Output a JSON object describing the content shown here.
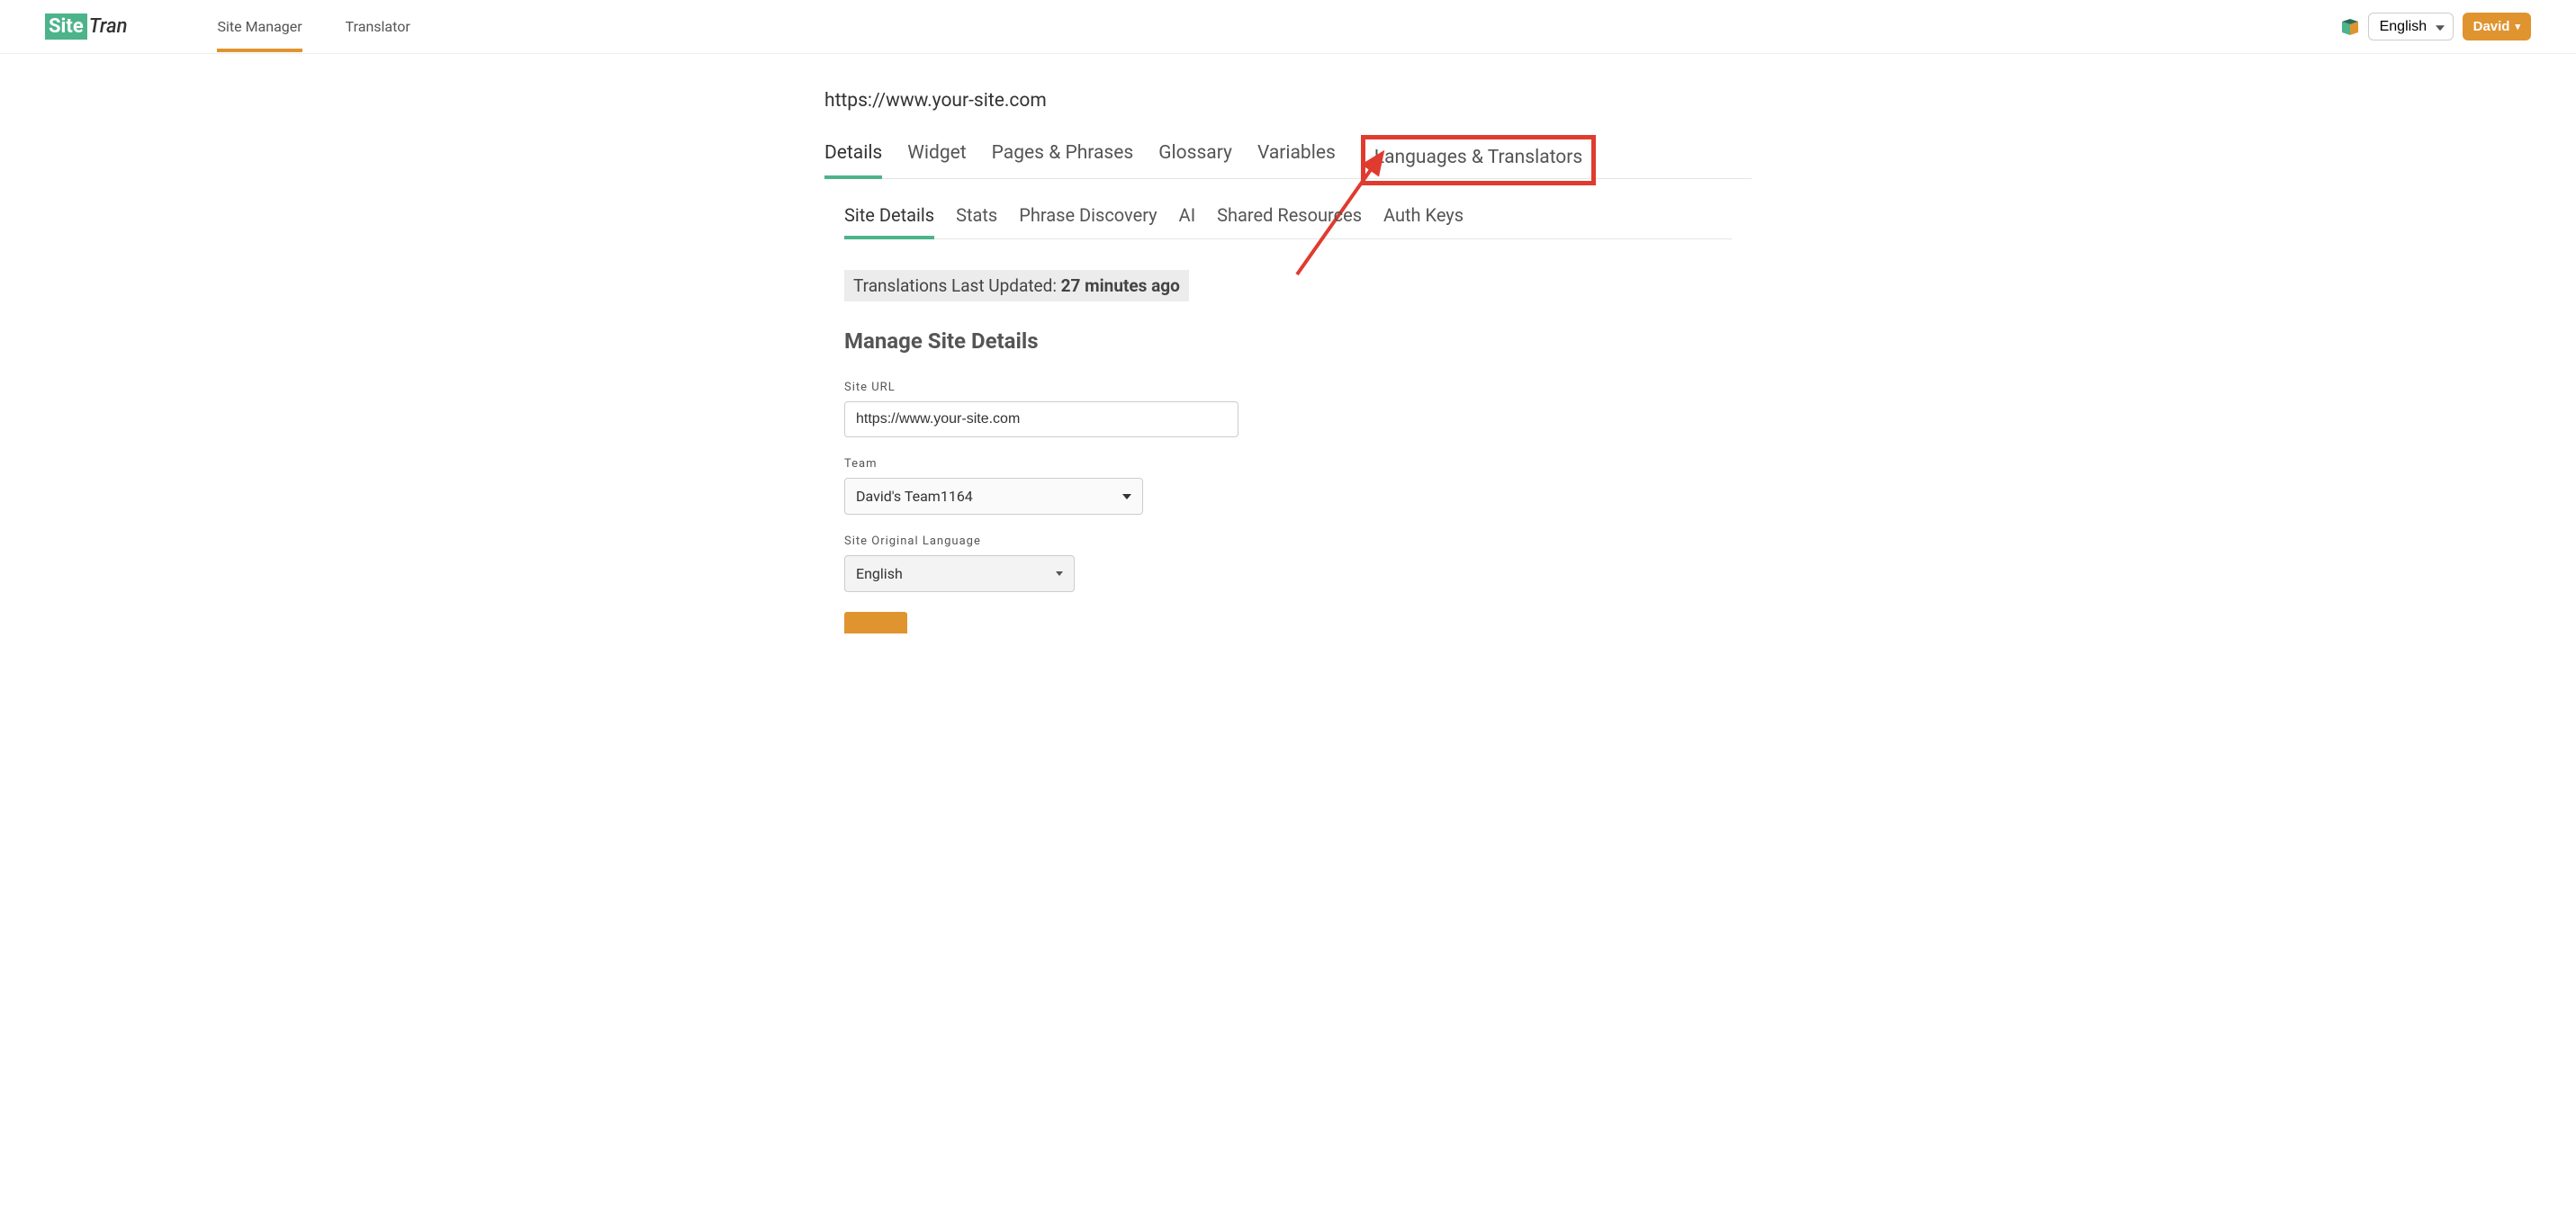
{
  "topnav": {
    "site_manager": "Site Manager",
    "translator": "Translator"
  },
  "header": {
    "language": "English",
    "user": "David"
  },
  "page": {
    "site_url_display": "https://www.your-site.com"
  },
  "tabs_primary": {
    "details": "Details",
    "widget": "Widget",
    "pages_phrases": "Pages & Phrases",
    "glossary": "Glossary",
    "variables": "Variables",
    "languages_translators": "Languages & Translators"
  },
  "tabs_secondary": {
    "site_details": "Site Details",
    "stats": "Stats",
    "phrase_discovery": "Phrase Discovery",
    "ai": "AI",
    "shared_resources": "Shared Resources",
    "auth_keys": "Auth Keys"
  },
  "status": {
    "prefix": "Translations Last Updated: ",
    "value": "27 minutes ago"
  },
  "section": {
    "title": "Manage Site Details"
  },
  "form": {
    "site_url_label": "Site URL",
    "site_url_value": "https://www.your-site.com",
    "team_label": "Team",
    "team_value": "David's Team1164",
    "orig_lang_label": "Site Original Language",
    "orig_lang_value": "English"
  }
}
